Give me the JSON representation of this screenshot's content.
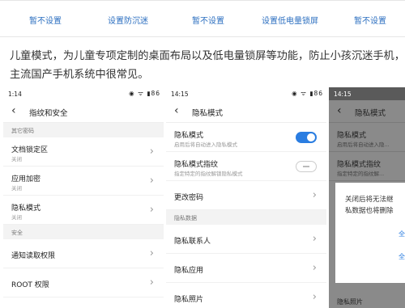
{
  "top_row": [
    "暂不设置",
    "设置防沉迷",
    "暂不设置",
    "设置低电量锁屏",
    "暂不设置"
  ],
  "paragraph": {
    "line1": "儿童模式，为儿童专项定制的桌面布局以及低电量锁屏等功能，防止小孩沉迷手机，在几大",
    "line2": "主流国产手机系统中很常见。"
  },
  "phone1": {
    "status": {
      "time": "1:14",
      "icons": "◉ ᯤ ▮86"
    },
    "title": "指纹和安全",
    "section1": "其它密码",
    "items": [
      {
        "label": "文档锁定区",
        "sub": "关闭"
      },
      {
        "label": "应用加密",
        "sub": "关闭"
      },
      {
        "label": "隐私模式",
        "sub": "关闭"
      }
    ],
    "section2": "安全",
    "items2": [
      {
        "label": "通知读取权限"
      },
      {
        "label": "ROOT 权限"
      }
    ]
  },
  "phone2": {
    "status": {
      "time": "14:15",
      "icons": "◉ ᯤ ▮86"
    },
    "title": "隐私模式",
    "items": [
      {
        "label": "隐私模式",
        "sub": "启用后将自动进入隐私模式",
        "toggle": "on"
      },
      {
        "label": "隐私模式指纹",
        "sub": "指定特定的指纹解锁隐私模式",
        "toggle": "off"
      },
      {
        "label": "更改密码"
      }
    ],
    "section": "隐私数据",
    "items2": [
      {
        "label": "隐私联系人"
      },
      {
        "label": "隐私应用"
      },
      {
        "label": "隐私照片"
      }
    ]
  },
  "phone3": {
    "status": {
      "time": "14:15"
    },
    "title": "隐私模式",
    "items": [
      {
        "label": "隐私模式",
        "sub": "启用后将自动进入隐..."
      },
      {
        "label": "隐私模式指纹",
        "sub": "指定特定的指纹解..."
      }
    ],
    "dialog": {
      "line1": "关闭后将无法继",
      "line2": "私数据也将删除",
      "btn1": "全",
      "btn2": "全"
    },
    "bottom": "隐私照片"
  },
  "colors": {
    "accent": "#2a7de1",
    "link": "#2c6fc0"
  }
}
